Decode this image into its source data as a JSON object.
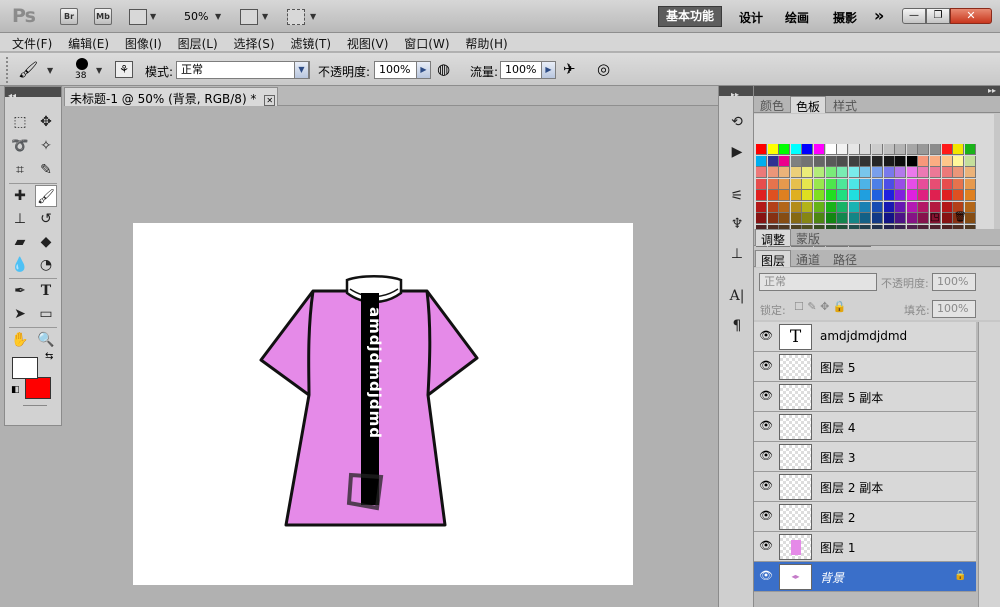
{
  "appbar": {
    "logo": "Ps",
    "bridge": "Br",
    "minibridge": "Mb",
    "zoom": "50%",
    "workspaces": [
      "基本功能",
      "设计",
      "绘画",
      "摄影"
    ],
    "more": "»"
  },
  "menus": [
    "文件(F)",
    "编辑(E)",
    "图像(I)",
    "图层(L)",
    "选择(S)",
    "滤镜(T)",
    "视图(V)",
    "窗口(W)",
    "帮助(H)"
  ],
  "options": {
    "brush_size": "38",
    "mode_label": "模式:",
    "mode_value": "正常",
    "opacity_label": "不透明度:",
    "opacity_value": "100%",
    "flow_label": "流量:",
    "flow_value": "100%"
  },
  "document": {
    "tab_title": "未标题-1 @ 50% (背景, RGB/8) *",
    "shirt_text": "amdjdmdjdmd",
    "shirt_color": "#e58ae8"
  },
  "panels": {
    "swatch_tabs": [
      "颜色",
      "色板",
      "样式"
    ],
    "adjust_tabs": [
      "调整",
      "蒙版"
    ],
    "layer_tabs": [
      "图层",
      "通道",
      "路径"
    ],
    "blend_mode": "正常",
    "opacity_label": "不透明度:",
    "opacity_value": "100%",
    "lock_label": "锁定:",
    "fill_label": "填充:",
    "fill_value": "100%"
  },
  "layers": [
    {
      "name": "amdjdmdjdmd",
      "type": "text"
    },
    {
      "name": "图层 5",
      "type": "pixel"
    },
    {
      "name": "图层 5 副本",
      "type": "pixel"
    },
    {
      "name": "图层 4",
      "type": "pixel"
    },
    {
      "name": "图层 3",
      "type": "pixel"
    },
    {
      "name": "图层 2 副本",
      "type": "pixel"
    },
    {
      "name": "图层 2",
      "type": "pixel"
    },
    {
      "name": "图层 1",
      "type": "pixel"
    },
    {
      "name": "背景",
      "type": "background",
      "selected": true
    }
  ],
  "colors": {
    "foreground": "#ffffff",
    "background": "#ff0000",
    "selection": "#3a6fc9"
  }
}
